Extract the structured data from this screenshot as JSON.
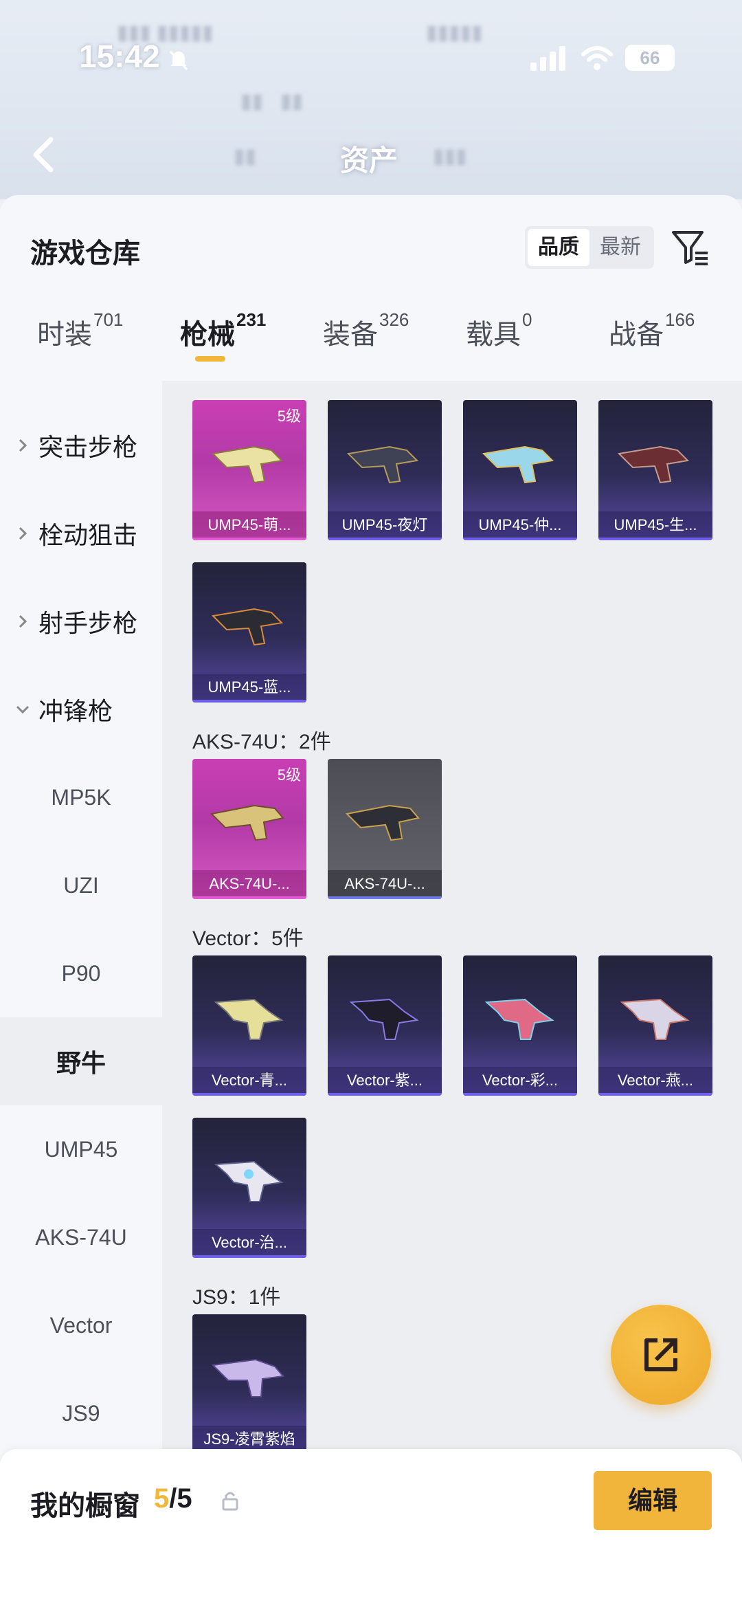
{
  "status_bar": {
    "time": "15:42",
    "battery": "66"
  },
  "header": {
    "title": "资产"
  },
  "sheet": {
    "title": "游戏仓库",
    "sort_options": [
      {
        "label": "品质",
        "active": true
      },
      {
        "label": "最新",
        "active": false
      }
    ]
  },
  "tabs": [
    {
      "label": "时装",
      "count": "701"
    },
    {
      "label": "枪械",
      "count": "231",
      "active": true
    },
    {
      "label": "装备",
      "count": "326"
    },
    {
      "label": "载具",
      "count": "0"
    },
    {
      "label": "战备",
      "count": "166"
    }
  ],
  "categories": [
    {
      "label": "突击步枪",
      "expanded": false
    },
    {
      "label": "栓动狙击",
      "expanded": false
    },
    {
      "label": "射手步枪",
      "expanded": false
    },
    {
      "label": "冲锋枪",
      "expanded": true
    }
  ],
  "subcategories": [
    "MP5K",
    "UZI",
    "P90",
    "野牛",
    "UMP45",
    "AKS-74U",
    "Vector",
    "JS9"
  ],
  "selected_subcategory": "野牛",
  "groups": [
    {
      "title": "",
      "items": [
        {
          "name": "UMP45-萌...",
          "tier": "gold",
          "level": "5级"
        },
        {
          "name": "UMP45-夜灯",
          "tier": "purple"
        },
        {
          "name": "UMP45-仲...",
          "tier": "purple"
        },
        {
          "name": "UMP45-生...",
          "tier": "purple"
        },
        {
          "name": "UMP45-蓝...",
          "tier": "purple"
        }
      ]
    },
    {
      "title": "AKS-74U：2件",
      "items": [
        {
          "name": "AKS-74U-...",
          "tier": "gold",
          "level": "5级"
        },
        {
          "name": "AKS-74U-...",
          "tier": "grey"
        }
      ]
    },
    {
      "title": "Vector：5件",
      "items": [
        {
          "name": "Vector-青...",
          "tier": "purple"
        },
        {
          "name": "Vector-紫...",
          "tier": "purple"
        },
        {
          "name": "Vector-彩...",
          "tier": "purple"
        },
        {
          "name": "Vector-燕...",
          "tier": "purple"
        },
        {
          "name": "Vector-治...",
          "tier": "purple"
        }
      ]
    },
    {
      "title": "JS9：1件",
      "items": [
        {
          "name": "JS9-凌霄紫焰",
          "tier": "purple"
        }
      ]
    }
  ],
  "showcase": {
    "title": "我的橱窗",
    "current": "5",
    "total": "/5",
    "edit_label": "编辑"
  },
  "colors": {
    "accent": "#f1b63a",
    "gold_card": "#c93fb4",
    "purple_card": "#2f2d58",
    "grey_card": "#5a5b63"
  }
}
